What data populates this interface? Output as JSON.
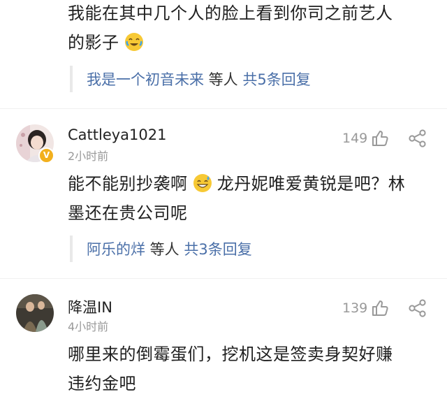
{
  "comments": [
    {
      "text_line1": "我能在其中几个人的脸上看到你司之前艺人",
      "text_line2": "的影子",
      "emoji": "laughing-crying-emoji",
      "reply": {
        "user": "我是一个初音未来",
        "middle": " 等人 ",
        "count": "共5条回复"
      }
    },
    {
      "username": "Cattleya1021",
      "time": "2小时前",
      "likes": "149",
      "text_line1a": "能不能别抄袭啊",
      "text_line1b": "龙丹妮唯爱黄锐是吧？林",
      "text_line2": "墨还在贵公司呢",
      "emoji": "sweat-smile-emoji",
      "badge": "V",
      "reply": {
        "user": "阿乐的烊",
        "middle": " 等人 ",
        "count": "共3条回复"
      }
    },
    {
      "username": "降温IN",
      "time": "4小时前",
      "likes": "139",
      "text_line1": "哪里来的倒霉蛋们，挖机这是签卖身契好赚",
      "text_line2": "违约金吧"
    }
  ],
  "colors": {
    "link": "#4a6fa8",
    "meta": "#999999",
    "badge": "#f2b01e"
  }
}
